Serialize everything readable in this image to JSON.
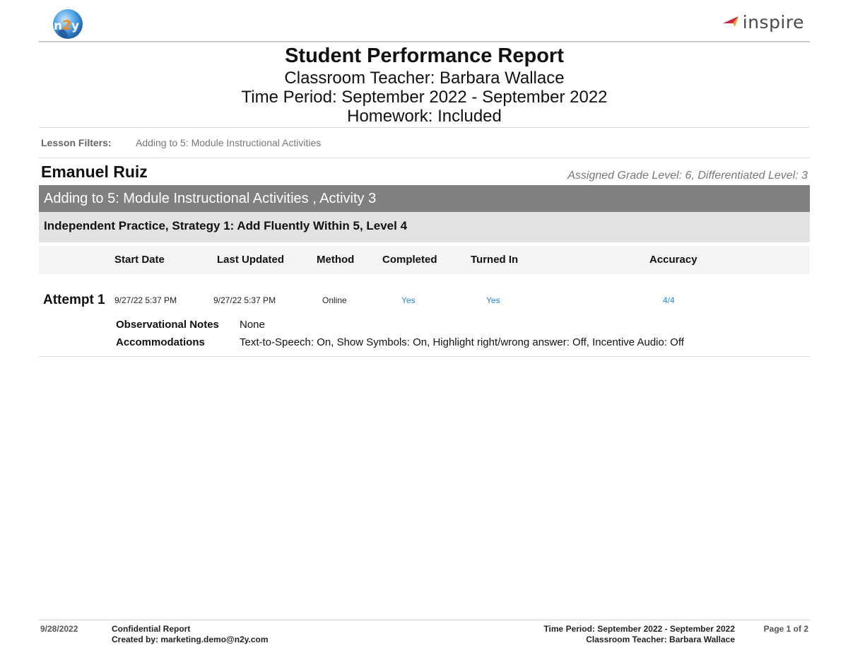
{
  "header": {
    "left_logo": "n2y-logo",
    "right_logo": {
      "icon": "inspire-arrow-icon",
      "text": "inspire"
    },
    "brand_colors": {
      "inspire_red": "#c8283c",
      "inspire_orange": "#f0a030",
      "n2y_blue": "#3a8fd8",
      "n2y_orange": "#f08a1c"
    }
  },
  "report": {
    "title": "Student Performance Report",
    "teacher_line": "Classroom Teacher: Barbara Wallace",
    "period_line": "Time Period: September 2022 - September 2022",
    "homework_line": "Homework: Included"
  },
  "filters": {
    "label": "Lesson Filters:",
    "value": "Adding to 5: Module Instructional Activities"
  },
  "student": {
    "name": "Emanuel Ruiz",
    "level_info": "Assigned Grade Level: 6, Differentiated Level: 3"
  },
  "activity": {
    "title": "Adding to 5: Module Instructional Activities , Activity 3",
    "strategy": "Independent Practice, Strategy 1: Add Fluently Within 5, Level 4"
  },
  "table": {
    "columns": [
      "Start Date",
      "Last Updated",
      "Method",
      "Completed",
      "Turned In",
      "Accuracy"
    ],
    "rows": [
      {
        "label": "Attempt 1",
        "start_date": "9/27/22 5:37 PM",
        "last_updated": "9/27/22 5:37 PM",
        "method": "Online",
        "completed": "Yes",
        "turned_in": "Yes",
        "accuracy": "4/4",
        "observational_notes_label": "Observational Notes",
        "observational_notes": "None",
        "accommodations_label": "Accommodations",
        "accommodations": "Text-to-Speech: On, Show Symbols: On, Highlight right/wrong answer: Off, Incentive Audio: Off"
      }
    ],
    "link_color": "#2f86d1"
  },
  "footer": {
    "date": "9/28/2022",
    "confidential": "Confidential Report",
    "created_by": "Created by: marketing.demo@n2y.com",
    "period": "Time Period: September 2022 - September 2022",
    "teacher": "Classroom Teacher: Barbara Wallace",
    "page": "Page 1 of 2"
  }
}
